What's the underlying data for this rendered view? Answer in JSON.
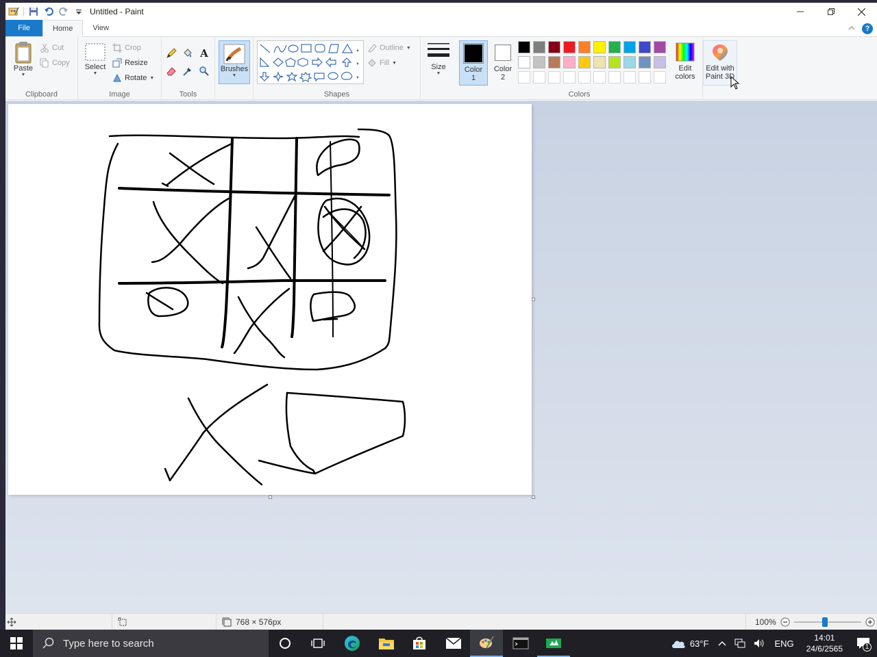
{
  "window": {
    "title": "Untitled - Paint"
  },
  "tabs": {
    "file": "File",
    "home": "Home",
    "view": "View"
  },
  "clipboard": {
    "paste": "Paste",
    "cut": "Cut",
    "copy": "Copy",
    "label": "Clipboard"
  },
  "image": {
    "select": "Select",
    "crop": "Crop",
    "resize": "Resize",
    "rotate": "Rotate",
    "label": "Image"
  },
  "tools": {
    "label": "Tools"
  },
  "brushes": {
    "label": "Brushes"
  },
  "shapes": {
    "outline": "Outline",
    "fill": "Fill",
    "label": "Shapes"
  },
  "size": {
    "label": "Size"
  },
  "colors": {
    "color1": "Color",
    "color1_num": "1",
    "color2": "Color",
    "color2_num": "2",
    "edit": "Edit",
    "edit2": "colors",
    "label": "Colors",
    "palette_row1": [
      "#000000",
      "#7f7f7f",
      "#880015",
      "#ed1c24",
      "#ff7f27",
      "#fff200",
      "#22b14c",
      "#00a2e8",
      "#3f48cc",
      "#a349a4"
    ],
    "palette_row2": [
      "#ffffff",
      "#c3c3c3",
      "#b97a57",
      "#ffaec9",
      "#ffc90e",
      "#efe4b0",
      "#b5e61d",
      "#99d9ea",
      "#7092be",
      "#c8bfe7"
    ]
  },
  "paint3d": {
    "line1": "Edit with",
    "line2": "Paint 3D"
  },
  "status": {
    "dimensions": "768 × 576px",
    "zoom": "100%",
    "zoom_value": 100
  },
  "taskbar": {
    "search_placeholder": "Type here to search",
    "weather": "63°F",
    "language": "ENG",
    "time": "14:01",
    "date": "24/6/2565",
    "notifications": "1"
  }
}
